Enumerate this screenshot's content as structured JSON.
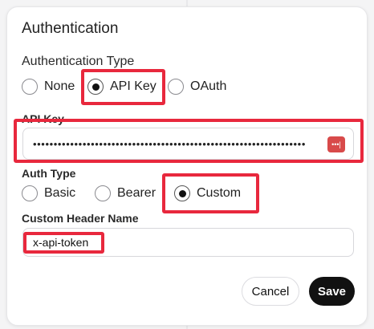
{
  "dialog": {
    "title": "Authentication",
    "auth_type_label": "Authentication Type",
    "auth_type_options": [
      {
        "label": "None",
        "checked": false
      },
      {
        "label": "API Key",
        "checked": true
      },
      {
        "label": "OAuth",
        "checked": false
      }
    ],
    "api_key_label": "API Key",
    "api_key_value": "••••••••••••••••••••••••••••••••••••••••••••••••••••••••••••••••••",
    "api_key_badge": "•••|",
    "header_auth_type_label": "Auth Type",
    "header_auth_type_options": [
      {
        "label": "Basic",
        "checked": false
      },
      {
        "label": "Bearer",
        "checked": false
      },
      {
        "label": "Custom",
        "checked": true
      }
    ],
    "custom_header_label": "Custom Header Name",
    "custom_header_value": "x-api-token",
    "cancel_label": "Cancel",
    "save_label": "Save"
  },
  "colors": {
    "highlight": "#e8283d",
    "save_button": "#111111",
    "key_badge": "#d84a4a"
  }
}
